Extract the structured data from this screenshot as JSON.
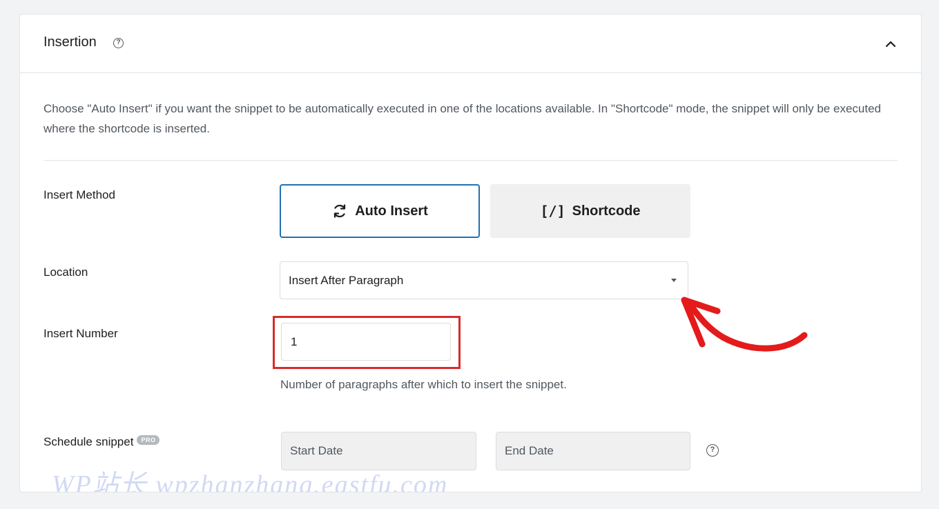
{
  "panel": {
    "title": "Insertion",
    "description": "Choose \"Auto Insert\" if you want the snippet to be automatically executed in one of the locations available. In \"Shortcode\" mode, the snippet will only be executed where the shortcode is inserted."
  },
  "insert_method": {
    "label": "Insert Method",
    "auto_insert_label": "Auto Insert",
    "shortcode_icon": "[/]",
    "shortcode_label": "Shortcode",
    "selected": "Auto Insert"
  },
  "location": {
    "label": "Location",
    "value": "Insert After Paragraph"
  },
  "insert_number": {
    "label": "Insert Number",
    "value": "1",
    "hint": "Number of paragraphs after which to insert the snippet."
  },
  "schedule": {
    "label": "Schedule snippet",
    "badge": "PRO",
    "start_placeholder": "Start Date",
    "end_placeholder": "End Date"
  },
  "watermark": "WP站长 wpzhanzhang.eastfu.com",
  "colors": {
    "accent": "#2271b1",
    "highlight": "#d92a2a",
    "background": "#f2f3f5"
  }
}
